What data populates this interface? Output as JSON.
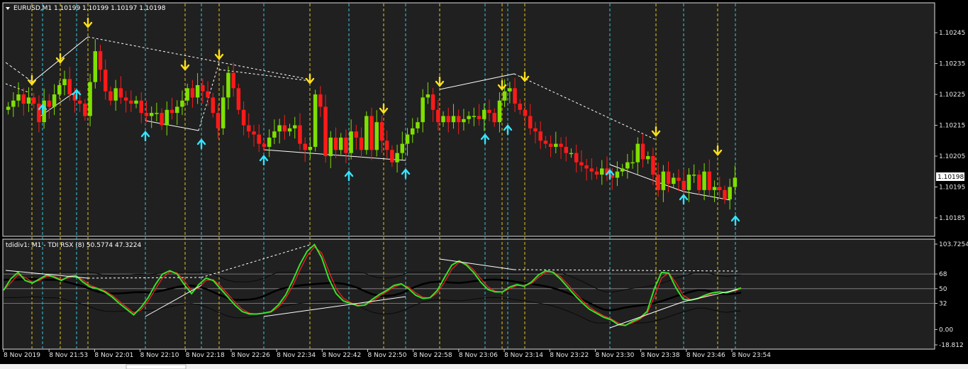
{
  "main_chart": {
    "title": "EURUSD,M1  1.10199 1.10199 1.10197 1.10198",
    "current_price_label": "1.10198",
    "y_ticks": [
      "1.10245",
      "1.10235",
      "1.10225",
      "1.10215",
      "1.10205",
      "1.10195",
      "1.10185"
    ],
    "colors": {
      "bull": "#7fe000",
      "bear": "#ff1a1a",
      "up_arrow": "#33e5ff",
      "down_arrow": "#ffe01a",
      "vline_yellow": "#e6c619",
      "vline_cyan": "#33c8e0",
      "trend": "#ffffff"
    }
  },
  "indicator": {
    "title": "tdidiv1: M1 - TDI RSX (8) 50.5774 47.3224",
    "y_ticks": [
      "103.7254",
      "68",
      "50",
      "32",
      "0.00",
      "-18.812"
    ],
    "levels": [
      68,
      50,
      32
    ],
    "colors": {
      "rsx": "#39e12a",
      "signal": "#ff2020",
      "band": "#1a1a1a",
      "mid": "#000000"
    }
  },
  "x_axis": {
    "labels": [
      "8 Nov 2019",
      "8 Nov 21:53",
      "8 Nov 22:01",
      "8 Nov 22:10",
      "8 Nov 22:18",
      "8 Nov 22:26",
      "8 Nov 22:34",
      "8 Nov 22:42",
      "8 Nov 22:50",
      "8 Nov 22:58",
      "8 Nov 23:06",
      "8 Nov 23:14",
      "8 Nov 23:22",
      "8 Nov 23:30",
      "8 Nov 23:38",
      "8 Nov 23:46",
      "8 Nov 23:54"
    ]
  },
  "chart_data": [
    {
      "type": "candlestick",
      "title": "EURUSD,M1",
      "ylim": [
        1.10182,
        1.10251
      ],
      "y_ticks": [
        1.10245,
        1.10235,
        1.10225,
        1.10215,
        1.10205,
        1.10195,
        1.10185
      ],
      "candles_close": [
        1.10221,
        1.10223,
        1.10225,
        1.10222,
        1.10224,
        1.10222,
        1.10216,
        1.10223,
        1.10221,
        1.10225,
        1.10228,
        1.1023,
        1.10225,
        1.10223,
        1.10222,
        1.10218,
        1.10229,
        1.10239,
        1.10233,
        1.10226,
        1.10223,
        1.10227,
        1.10224,
        1.10223,
        1.10222,
        1.10223,
        1.10219,
        1.10218,
        1.10219,
        1.10219,
        1.10215,
        1.1022,
        1.10219,
        1.10221,
        1.10223,
        1.10227,
        1.10224,
        1.10228,
        1.10226,
        1.10224,
        1.10219,
        1.10214,
        1.10224,
        1.10232,
        1.10227,
        1.1022,
        1.10215,
        1.10213,
        1.10212,
        1.10209,
        1.10208,
        1.10211,
        1.10213,
        1.10215,
        1.10213,
        1.10214,
        1.10215,
        1.10209,
        1.10207,
        1.10208,
        1.10225,
        1.10221,
        1.10205,
        1.10211,
        1.10207,
        1.10211,
        1.10206,
        1.10213,
        1.10211,
        1.10207,
        1.10218,
        1.10207,
        1.10216,
        1.1021,
        1.10207,
        1.10203,
        1.10206,
        1.10209,
        1.10212,
        1.10214,
        1.10216,
        1.10224,
        1.10225,
        1.1022,
        1.10216,
        1.10218,
        1.10216,
        1.10218,
        1.10216,
        1.10217,
        1.10218,
        1.10218,
        1.10217,
        1.1022,
        1.10219,
        1.10216,
        1.10223,
        1.10226,
        1.10227,
        1.10222,
        1.1022,
        1.10218,
        1.10214,
        1.10213,
        1.1021,
        1.10209,
        1.10208,
        1.10209,
        1.10208,
        1.10206,
        1.10206,
        1.10203,
        1.10202,
        1.10201,
        1.102,
        1.10199,
        1.10201,
        1.10199,
        1.10198,
        1.102,
        1.10201,
        1.10203,
        1.10203,
        1.10209,
        1.10204,
        1.10205,
        1.10199,
        1.10194,
        1.102,
        1.10196,
        1.10198,
        1.10197,
        1.10194,
        1.10199,
        1.10199,
        1.10194,
        1.102,
        1.10194,
        1.10195,
        1.10194,
        1.10191,
        1.10195,
        1.10198
      ],
      "up_arrow_count": 14,
      "down_arrow_count": 11
    },
    {
      "type": "line",
      "title": "tdidiv1: M1 - TDI RSX (8) 50.5774 47.3224",
      "ylim": [
        -18.812,
        103.7254
      ],
      "levels": [
        68,
        50,
        32
      ],
      "series": [
        {
          "name": "TDI RSX",
          "values": [
            48,
            62,
            70,
            60,
            57,
            62,
            67,
            64,
            60,
            65,
            66,
            58,
            52,
            50,
            46,
            40,
            32,
            25,
            18,
            27,
            39,
            55,
            68,
            72,
            68,
            55,
            44,
            55,
            63,
            60,
            50,
            40,
            30,
            22,
            19,
            19,
            20,
            22,
            30,
            42,
            60,
            80,
            96,
            104,
            88,
            62,
            44,
            35,
            32,
            29,
            30,
            37,
            43,
            48,
            54,
            56,
            50,
            42,
            38,
            39,
            48,
            64,
            79,
            84,
            79,
            70,
            58,
            49,
            46,
            46,
            52,
            55,
            53,
            58,
            67,
            72,
            70,
            62,
            52,
            42,
            33,
            25,
            20,
            15,
            12,
            6,
            5,
            10,
            14,
            22,
            50,
            70,
            69,
            51,
            37,
            36,
            38,
            42,
            45,
            46,
            45,
            48,
            51
          ]
        }
      ]
    }
  ]
}
